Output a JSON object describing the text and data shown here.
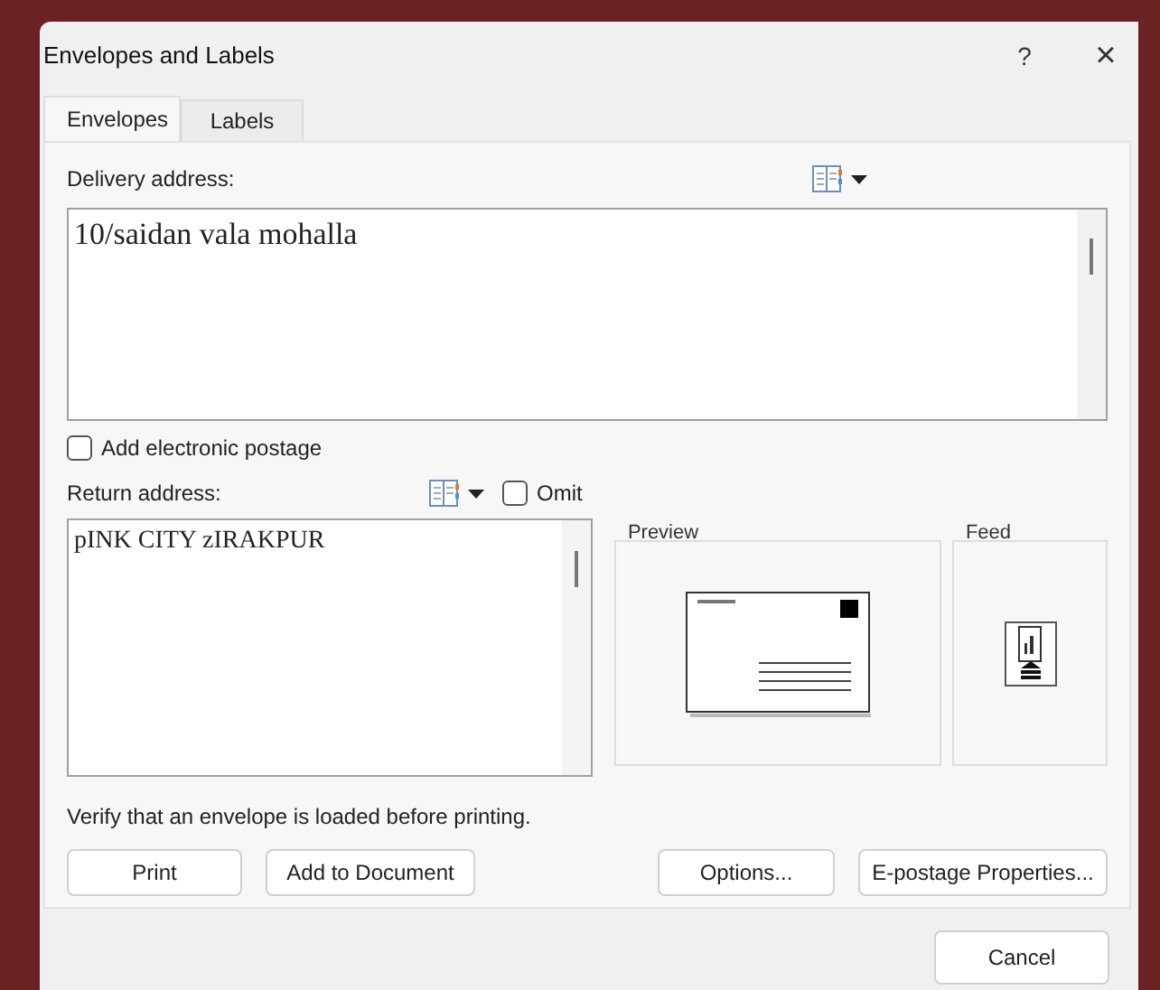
{
  "window": {
    "title": "Envelopes and Labels",
    "help": "?",
    "close": "×"
  },
  "tabs": [
    {
      "label": "Envelopes",
      "selected": true
    },
    {
      "label": "Labels",
      "selected": false
    }
  ],
  "delivery": {
    "label": "Delivery address:",
    "value": "10/saidan vala mohalla"
  },
  "electronic_postage": {
    "label": "Add electronic postage",
    "checked": false
  },
  "return": {
    "label": "Return address:",
    "value": "pINK CITY zIRAKPUR",
    "omit": {
      "label": "Omit",
      "checked": false
    }
  },
  "preview": {
    "title": "Preview"
  },
  "feed": {
    "title": "Feed"
  },
  "note": "Verify that an envelope is loaded before printing.",
  "buttons_left": [
    "Print",
    "Add to Document"
  ],
  "buttons_right": [
    "Options...",
    "E-postage Properties..."
  ],
  "cancel": "Cancel"
}
